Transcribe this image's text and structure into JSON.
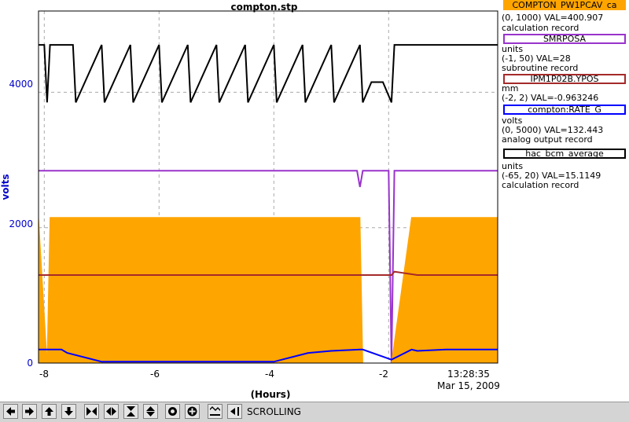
{
  "title": "compton.stp",
  "y_axis": {
    "label": "volts",
    "ticks": [
      "4000",
      "2000",
      "0"
    ],
    "color": "#0000cc"
  },
  "x_axis": {
    "label": "(Hours)",
    "ticks": [
      "-8",
      "-6",
      "-4",
      "-2"
    ],
    "time": "13:28:35",
    "date": "Mar 15, 2009"
  },
  "legend": [
    {
      "name": "COMPTON_PW1PCAV_ca",
      "units": "",
      "range_value": "(0, 1000) VAL=400.907",
      "record": "calculation record",
      "color": "#ffa500"
    },
    {
      "name": "SMRPOSA",
      "units": "units",
      "range_value": "(-1, 50) VAL=28",
      "record": "subroutine record",
      "color": "#9933cc"
    },
    {
      "name": "IPM1P02B.YPOS",
      "units": "mm",
      "range_value": "(-2, 2) VAL=-0.963246",
      "record": "",
      "color": "#a52a2a"
    },
    {
      "name": "compton:RATE_G",
      "units": "volts",
      "range_value": "(0, 5000) VAL=132.443",
      "record": "analog output record",
      "color": "#0000ff"
    },
    {
      "name": "hac_bcm_average",
      "units": "units",
      "range_value": "(-65, 20) VAL=15.1149",
      "record": "calculation record",
      "color": "#000000"
    }
  ],
  "toolbar": {
    "status": "SCROLLING",
    "buttons": [
      "left-arrow-icon",
      "right-arrow-icon",
      "up-arrow-icon",
      "down-arrow-icon",
      "zoom-in-horizontal-icon",
      "zoom-out-horizontal-icon",
      "zoom-in-vertical-icon",
      "zoom-out-vertical-icon",
      "reset-icon",
      "add-icon",
      "autoscale-icon",
      "scroll-icon"
    ]
  },
  "chart_data": {
    "type": "line",
    "title": "compton.stp",
    "xlabel": "(Hours)",
    "ylabel": "volts",
    "xlim": [
      -8.1,
      -0.1
    ],
    "ylim": [
      0,
      5200
    ],
    "grid": true,
    "series": [
      {
        "name": "hac_bcm_average",
        "color": "#000000",
        "x": [
          -8.1,
          -8.0,
          -7.95,
          -7.9,
          -7.5,
          -7.45,
          -7.0,
          -6.95,
          -6.5,
          -6.45,
          -6.0,
          -5.95,
          -5.5,
          -5.45,
          -5.0,
          -4.95,
          -4.5,
          -4.45,
          -4.0,
          -3.95,
          -3.5,
          -3.45,
          -3.0,
          -2.95,
          -2.5,
          -2.45,
          -2.3,
          -2.1,
          -1.95,
          -1.9,
          -1.5,
          -1.0,
          -0.5,
          -0.1
        ],
        "y": [
          4700,
          4700,
          3850,
          4700,
          4700,
          3850,
          4700,
          3850,
          4700,
          3850,
          4700,
          3850,
          4700,
          3850,
          4700,
          3850,
          4700,
          3850,
          4700,
          3850,
          4700,
          3850,
          4700,
          3850,
          4700,
          3850,
          4150,
          4150,
          3850,
          4700,
          4700,
          4700,
          4700,
          4700
        ]
      },
      {
        "name": "SMRPOSA",
        "color": "#9933cc",
        "x": [
          -8.1,
          -2.55,
          -2.5,
          -2.45,
          -2.0,
          -1.95,
          -1.9,
          -0.1
        ],
        "y": [
          2840,
          2840,
          2600,
          2840,
          2840,
          0,
          2840,
          2840
        ]
      },
      {
        "name": "COMPTON_PW1PCAV_ca",
        "color": "#ffa500",
        "x": [
          -8.1,
          -7.95,
          -7.9,
          -7.5,
          -7.0,
          -6.5,
          -6.0,
          -5.5,
          -5.0,
          -4.5,
          -4.0,
          -3.5,
          -3.0,
          -2.5,
          -2.45,
          -1.95,
          -1.6,
          -1.5,
          -1.0,
          -0.5,
          -0.1
        ],
        "y": [
          2150,
          0,
          2150,
          2150,
          2150,
          2150,
          2150,
          2150,
          2150,
          2150,
          2150,
          2150,
          2150,
          2150,
          0,
          0,
          2150,
          2150,
          2150,
          2150,
          2150
        ]
      },
      {
        "name": "IPM1P02B.YPOS",
        "color": "#a52a2a",
        "x": [
          -8.1,
          -7.5,
          -7.0,
          -6.5,
          -6.0,
          -5.5,
          -5.0,
          -4.5,
          -4.0,
          -3.5,
          -3.0,
          -2.5,
          -2.45,
          -1.95,
          -1.9,
          -1.5,
          -1.0,
          -0.5,
          -0.1
        ],
        "y": [
          1300,
          1300,
          1300,
          1300,
          1300,
          1300,
          1300,
          1300,
          1300,
          1300,
          1300,
          1300,
          1300,
          1300,
          1350,
          1300,
          1300,
          1300,
          1300
        ]
      },
      {
        "name": "compton:RATE_G",
        "color": "#0000ff",
        "x": [
          -8.1,
          -7.7,
          -7.6,
          -7.0,
          -6.0,
          -5.0,
          -4.0,
          -3.4,
          -3.0,
          -2.5,
          -2.45,
          -1.95,
          -1.6,
          -1.5,
          -1.0,
          -0.5,
          -0.1
        ],
        "y": [
          200,
          200,
          150,
          20,
          20,
          20,
          20,
          150,
          180,
          200,
          200,
          50,
          200,
          180,
          200,
          200,
          200
        ]
      }
    ]
  }
}
